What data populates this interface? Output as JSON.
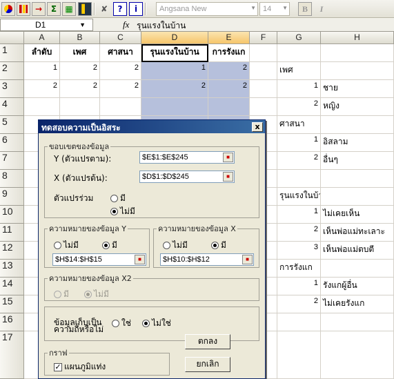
{
  "toolbar": {
    "font_name": "Angsana New",
    "font_size": "14",
    "bold_label": "B",
    "italic_label": "I",
    "icons": [
      "pie-chart-icon",
      "bar-chart-icon",
      "arrow-right-icon",
      "sigma-icon",
      "chart-wizard-icon",
      "chart-bars-icon",
      "tools-icon",
      "help-icon",
      "info-icon"
    ]
  },
  "formula_bar": {
    "cell_ref": "D1",
    "fx_label": "fx",
    "value": "รุนแรงในบ้าน"
  },
  "columns": [
    "A",
    "B",
    "C",
    "D",
    "E",
    "F",
    "G",
    "H"
  ],
  "rows": [
    "1",
    "2",
    "3",
    "4",
    "5",
    "6",
    "7",
    "8",
    "9",
    "10",
    "11",
    "12",
    "13",
    "14",
    "15",
    "16",
    "17"
  ],
  "cells": {
    "header": [
      "ลำดับ",
      "เพศ",
      "ศาสนา",
      "รุนแรงในบ้าน",
      "การรังแก"
    ],
    "row2": [
      "1",
      "2",
      "2",
      "1",
      "2"
    ],
    "row3": [
      "2",
      "2",
      "2",
      "2",
      "2"
    ],
    "g": {
      "r2": "เพศ",
      "r5": "ศาสนา",
      "r9": "รุนแรงในบ้าน",
      "r13": "การรังแก"
    },
    "gnum": {
      "r3": "1",
      "r4": "2",
      "r6": "1",
      "r7": "2",
      "r10": "1",
      "r11": "2",
      "r12": "3",
      "r14": "1",
      "r15": "2"
    },
    "h": {
      "r3": "ชาย",
      "r4": "หญิง",
      "r6": "อิสลาม",
      "r7": "อื่นๆ",
      "r10": "ไม่เคยเห็น",
      "r11": "เห็นพ่อแม่ทะเลาะ",
      "r12": "เห็นพ่อแม่ตบตี",
      "r14": "รังแกผู้อื่น",
      "r15": "ไม่เคยรังแก"
    }
  },
  "dialog": {
    "title": "ทดสอบความเป็นอิสระ",
    "close_label": "x",
    "range_group": "ขอบเขตของข้อมูล",
    "y_label": "Y (ตัวแปรตาม):",
    "y_value": "$E$1:$E$245",
    "x_label": "X (ตัวแปรต้น):",
    "x_value": "$D$1:$D$245",
    "covariate_label": "ตัวแปรร่วม",
    "opt_yes": "มี",
    "opt_no": "ไม่มี",
    "y_meaning_group": "ความหมายของข้อมูล Y",
    "y_meaning_value": "$H$14:$H$15",
    "x_meaning_group": "ความหมายของข้อมูล X",
    "x_meaning_value": "$H$10:$H$12",
    "x2_meaning_group": "ความหมายของข้อมูล X2",
    "stored_label_1": "ข้อมูลเก็บเป็น",
    "stored_label_2": "ความถี่หรือไม่",
    "opt_yes2": "ใช่",
    "opt_no2": "ไม่ใช่",
    "graph_group": "กราฟ",
    "graph_check_label": "แผนภูมิแท่ง",
    "ok_label": "ตกลง",
    "cancel_label": "ยกเลิก"
  }
}
